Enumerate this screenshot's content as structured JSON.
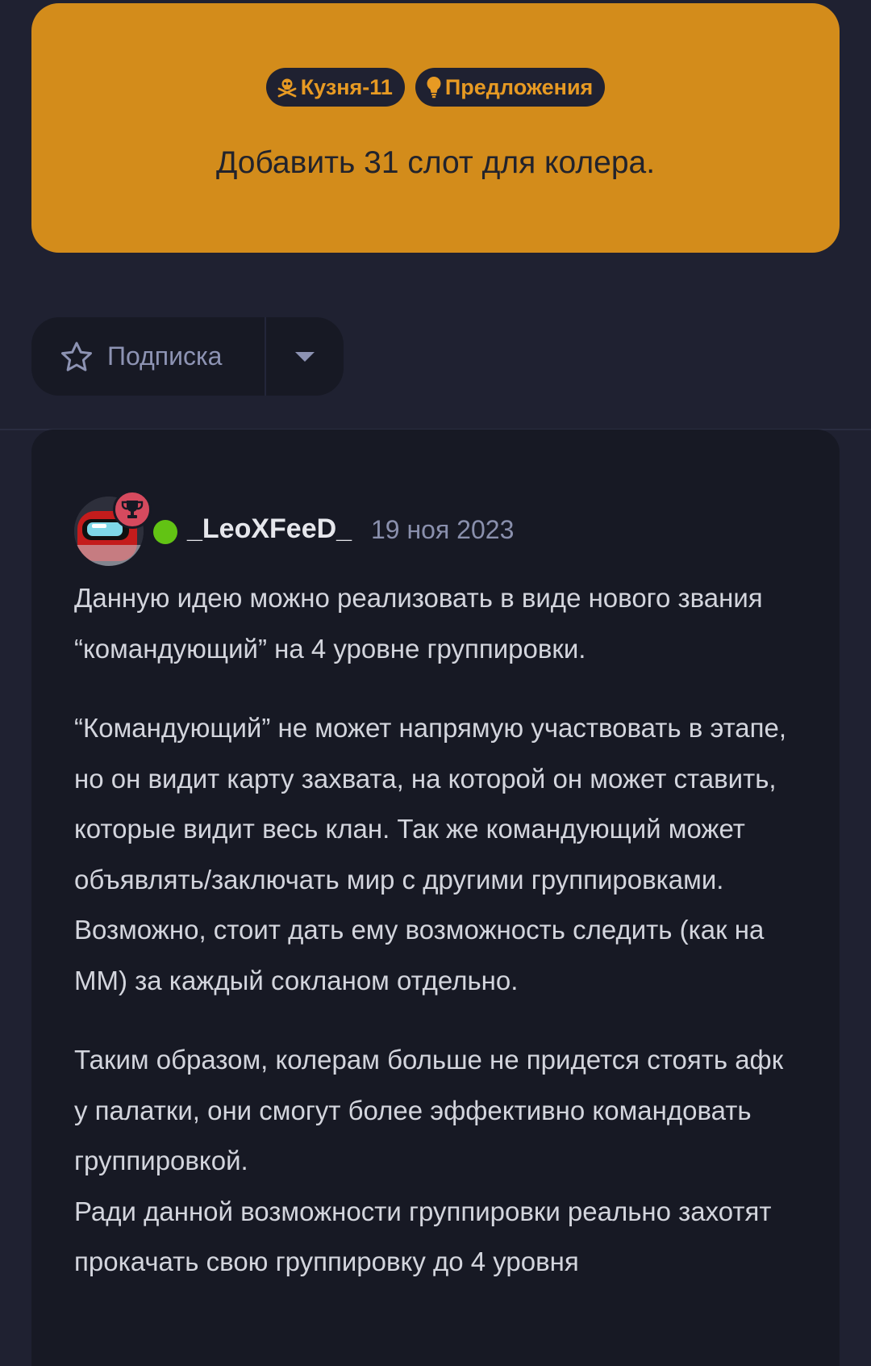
{
  "topic": {
    "tags": [
      {
        "label": "Кузня-11",
        "icon": "skull-crossbones-icon"
      },
      {
        "label": "Предложения",
        "icon": "lightbulb-icon"
      }
    ],
    "title": "Добавить 31 слот для колера."
  },
  "subscribe": {
    "label": "Подписка",
    "icon": "star-outline-icon",
    "dropdown_icon": "caret-down-icon"
  },
  "post": {
    "author": "_LeoXFeeD_",
    "date": "19 ноя 2023",
    "online": true,
    "badge_icon": "trophy-icon",
    "paragraphs": [
      "Данную идею можно реализовать в виде нового звания “командующий” на 4 уровне группировки.",
      "“Командующий” не может напрямую участвовать в этапе, но он видит карту захвата, на которой он может ставить, которые видит весь клан. Так же командующий может объявлять/заключать мир с другими группировками. Возможно, стоит дать ему возможность следить (как на ММ) за каждый сокланом отдельно.",
      "Таким образом, колерам больше не придется стоять афк у палатки, они смогут более эффективно командовать группировкой.",
      "Ради данной возможности группировки реально захотят прокачать свою группировку до 4 уровня"
    ]
  },
  "colors": {
    "background": "#1f2131",
    "banner": "#d38c1b",
    "card": "#171924",
    "accent": "#e79a23",
    "online": "#62c314",
    "badge": "#d64a5e"
  }
}
